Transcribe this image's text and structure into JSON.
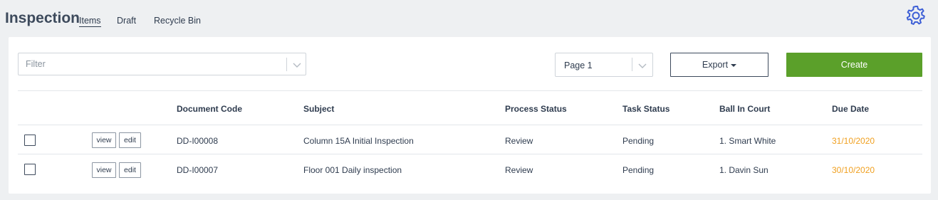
{
  "header": {
    "title": "Inspection",
    "tabs": [
      {
        "label": "Items",
        "active": true
      },
      {
        "label": "Draft",
        "active": false
      },
      {
        "label": "Recycle Bin",
        "active": false
      }
    ],
    "settings_icon": "gear-icon"
  },
  "toolbar": {
    "filter_placeholder": "Filter",
    "page_select_value": "Page 1",
    "export_label": "Export",
    "create_label": "Create"
  },
  "table": {
    "columns": [
      "Document Code",
      "Subject",
      "Process Status",
      "Task Status",
      "Ball In Court",
      "Due Date"
    ],
    "row_actions": {
      "view": "view",
      "edit": "edit"
    },
    "rows": [
      {
        "document_code": "DD-I00008",
        "subject": "Column 15A Initial Inspection",
        "process_status": "Review",
        "task_status": "Pending",
        "ball_in_court": "1. Smart White",
        "due_date": "31/10/2020"
      },
      {
        "document_code": "DD-I00007",
        "subject": "Floor 001 Daily inspection",
        "process_status": "Review",
        "task_status": "Pending",
        "ball_in_court": "1. Davin Sun",
        "due_date": "30/10/2020"
      }
    ]
  },
  "colors": {
    "accent_green": "#5ba02a",
    "due_date_orange": "#f0a020",
    "gear_blue": "#3d5fd6",
    "background": "#eef0f2"
  }
}
